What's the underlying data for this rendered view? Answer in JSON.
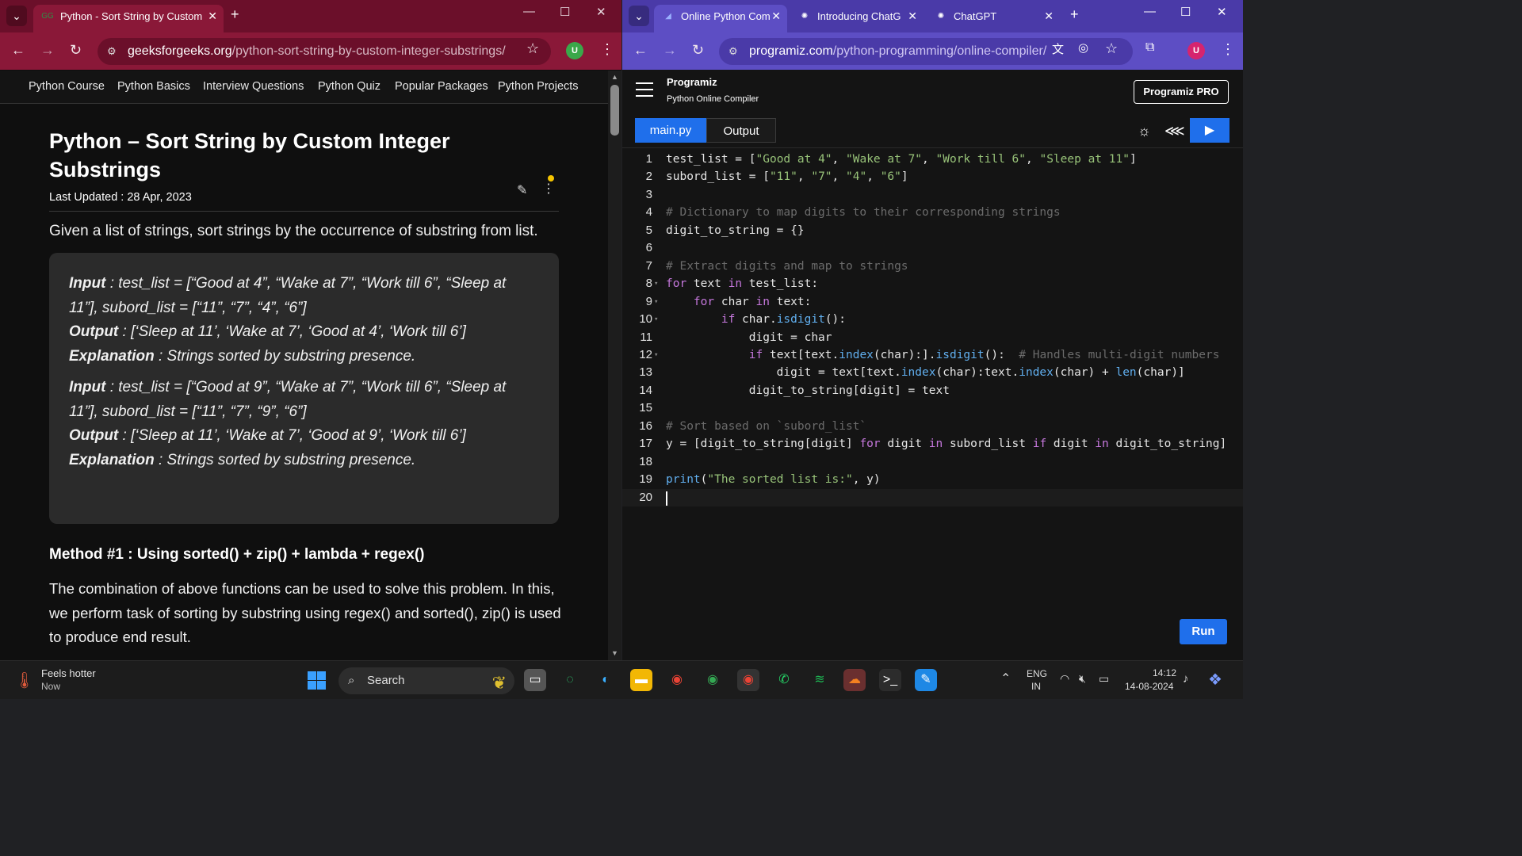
{
  "left_browser": {
    "tab_title": "Python - Sort String by Custom",
    "url_domain": "geeksforgeeks.org",
    "url_path": "/python-sort-string-by-custom-integer-substrings/",
    "profile_initial": "U"
  },
  "gfg": {
    "nav": [
      "Python Course",
      "Python Basics",
      "Interview Questions",
      "Python Quiz",
      "Popular Packages",
      "Python Projects"
    ],
    "title": "Python – Sort String by Custom Integer Substrings",
    "updated": "Last Updated : 28 Apr, 2023",
    "intro": "Given a list of strings, sort strings by the occurrence of substring from list.",
    "examples": [
      {
        "input_label": "Input",
        "input_text": " : test_list = [“Good at 4”, “Wake at 7”, “Work till 6”, “Sleep at 11”], subord_list = [“11”, “7”, “4”, “6”]",
        "output_label": "Output",
        "output_text": " : [‘Sleep at 11’, ‘Wake at 7’, ‘Good at 4’, ‘Work till 6’]",
        "expl_label": "Explanation",
        "expl_text": " : Strings sorted by substring presence."
      },
      {
        "input_label": "Input",
        "input_text": " : test_list = [“Good at 9”, “Wake at 7”, “Work till 6”, “Sleep at 11”], subord_list = [“11”, “7”, “9”, “6”]",
        "output_label": "Output",
        "output_text": " : [‘Sleep at 11’, ‘Wake at 7’, ‘Good at 9’, ‘Work till 6’]",
        "expl_label": "Explanation",
        "expl_text": " : Strings sorted by substring presence."
      }
    ],
    "method_heading": "Method #1 : Using sorted() + zip() + lambda + regex()",
    "method_text": "The combination of above functions can be used to solve this problem. In this, we perform task of sorting by substring using regex() and sorted(), zip() is used to produce end result."
  },
  "right_browser": {
    "tabs": [
      "Online Python Com",
      "Introducing ChatG",
      "ChatGPT"
    ],
    "url_domain": "programiz.com",
    "url_path": "/python-programming/online-compiler/",
    "profile_initial": "U"
  },
  "programiz": {
    "logo": "Programiz",
    "subtitle": "Python Online Compiler",
    "pro_button": "Programiz PRO",
    "tab_file": "main.py",
    "tab_output": "Output",
    "run_label": "Run",
    "code_lines": [
      "test_list = [\"Good at 4\", \"Wake at 7\", \"Work till 6\", \"Sleep at 11\"]",
      "subord_list = [\"11\", \"7\", \"4\", \"6\"]",
      "",
      "# Dictionary to map digits to their corresponding strings",
      "digit_to_string = {}",
      "",
      "# Extract digits and map to strings",
      "for text in test_list:",
      "    for char in text:",
      "        if char.isdigit():",
      "            digit = char",
      "            if text[text.index(char):].isdigit():  # Handles multi-digit numbers",
      "                digit = text[text.index(char):text.index(char) + len(char)]",
      "            digit_to_string[digit] = text",
      "",
      "# Sort based on `subord_list`",
      "y = [digit_to_string[digit] for digit in subord_list if digit in digit_to_string]",
      "",
      "print(\"The sorted list is:\", y)",
      ""
    ]
  },
  "taskbar": {
    "weather_title": "Feels hotter",
    "weather_sub": "Now",
    "search_placeholder": "Search",
    "lang_top": "ENG",
    "lang_bottom": "IN",
    "time": "14:12",
    "date": "14-08-2024"
  },
  "colors": {
    "gfg_frame": "#8a1838",
    "programiz_frame": "#5d4ec4",
    "accent_blue": "#1f6feb"
  }
}
